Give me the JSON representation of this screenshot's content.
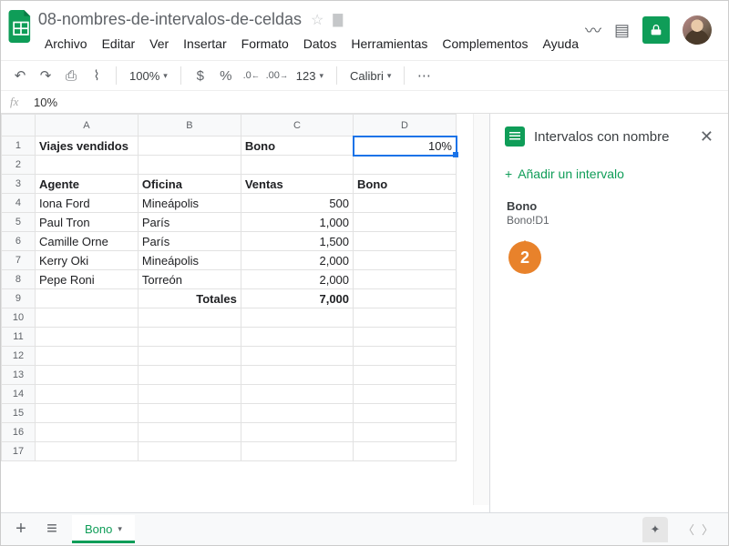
{
  "doc_title": "08-nombres-de-intervalos-de-celdas",
  "menus": [
    "Archivo",
    "Editar",
    "Ver",
    "Insertar",
    "Formato",
    "Datos",
    "Herramientas",
    "Complementos",
    "Ayuda"
  ],
  "toolbar": {
    "zoom": "100%",
    "currency": "$",
    "percent": "%",
    "dec_dec": ".0",
    "dec_inc": ".00",
    "fmt_more": "123",
    "font": "Calibri",
    "more": "⋯"
  },
  "formula_bar": {
    "label": "fx",
    "value": "10%"
  },
  "columns": [
    "A",
    "B",
    "C",
    "D"
  ],
  "grid": {
    "r1": {
      "A": "Viajes vendidos",
      "C": "Bono",
      "D": "10%"
    },
    "r3": {
      "A": "Agente",
      "B": "Oficina",
      "C": "Ventas",
      "D": "Bono"
    },
    "r4": {
      "A": "Iona Ford",
      "B": "Mineápolis",
      "C": "500"
    },
    "r5": {
      "A": "Paul Tron",
      "B": "París",
      "C": "1,000"
    },
    "r6": {
      "A": "Camille Orne",
      "B": "París",
      "C": "1,500"
    },
    "r7": {
      "A": "Kerry Oki",
      "B": "Mineápolis",
      "C": "2,000"
    },
    "r8": {
      "A": "Pepe Roni",
      "B": "Torreón",
      "C": "2,000"
    },
    "r9": {
      "B": "Totales",
      "C": "7,000"
    }
  },
  "side_panel": {
    "title": "Intervalos con nombre",
    "add_label": "Añadir un intervalo",
    "item_name": "Bono",
    "item_range": "Bono!D1"
  },
  "callout_num": "2",
  "sheet_tab": "Bono"
}
